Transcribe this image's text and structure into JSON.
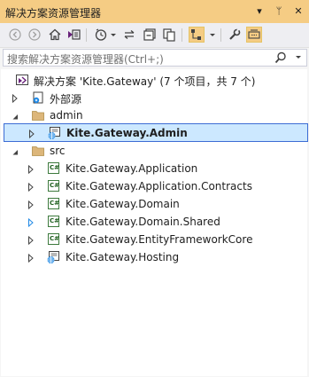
{
  "window": {
    "title": "解决方案资源管理器",
    "pin_symbol": "ᛘ",
    "close_symbol": "✕"
  },
  "search": {
    "placeholder": "搜索解决方案资源管理器(Ctrl+;)"
  },
  "tree": {
    "solution": "解决方案 'Kite.Gateway' (7 个项目，共 7 个)",
    "external_sources": "外部源",
    "folder_admin": "admin",
    "admin_project": "Kite.Gateway.Admin",
    "folder_src": "src",
    "projects": [
      "Kite.Gateway.Application",
      "Kite.Gateway.Application.Contracts",
      "Kite.Gateway.Domain",
      "Kite.Gateway.Domain.Shared",
      "Kite.Gateway.EntityFrameworkCore",
      "Kite.Gateway.Hosting"
    ],
    "cs_badge": "C#"
  },
  "colors": {
    "title_bar": "#F5CC84",
    "selection_fill": "#CCE8FF",
    "selection_border": "#3C6CD4",
    "folder": "#DCB67A",
    "csharp_green": "#3D7A3D"
  }
}
